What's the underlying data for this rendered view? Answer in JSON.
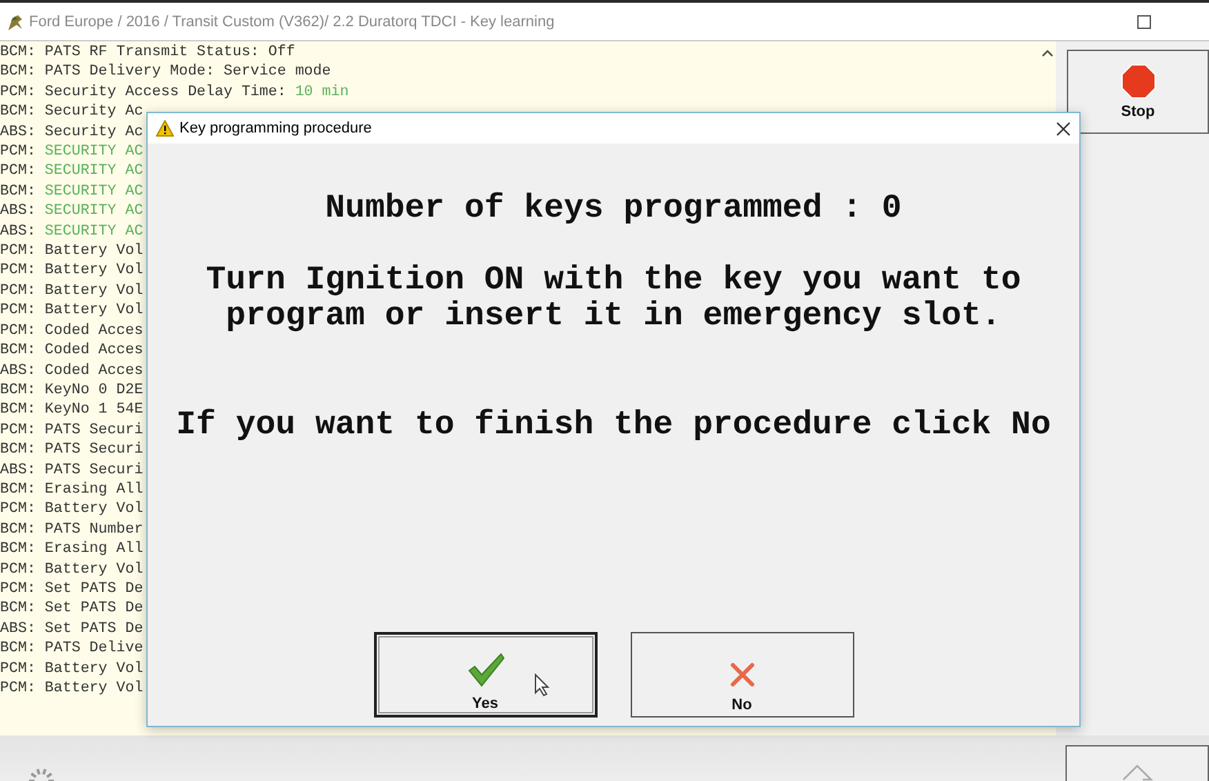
{
  "window": {
    "title": "Ford Europe / 2016 / Transit Custom (V362)/ 2.2 Duratorq TDCI - Key learning"
  },
  "log": {
    "lines": [
      {
        "text": "BCM: PATS RF Transmit Status: Off"
      },
      {
        "text": "BCM: PATS Delivery Mode: Service mode"
      },
      {
        "text": "PCM: Security Access Delay Time: ",
        "value": "10 min"
      },
      {
        "text": "BCM: Security Ac"
      },
      {
        "text": "ABS: Security Ac"
      },
      {
        "text": "PCM: ",
        "value": "SECURITY AC"
      },
      {
        "text": "PCM: ",
        "value": "SECURITY AC"
      },
      {
        "text": "BCM: ",
        "value": "SECURITY AC"
      },
      {
        "text": "ABS: ",
        "value": "SECURITY AC"
      },
      {
        "text": "ABS: ",
        "value": "SECURITY AC"
      },
      {
        "text": "PCM: Battery Vol"
      },
      {
        "text": "PCM: Battery Vol"
      },
      {
        "text": "PCM: Battery Vol"
      },
      {
        "text": "PCM: Battery Vol"
      },
      {
        "text": "PCM: Coded Acces"
      },
      {
        "text": "BCM: Coded Acces"
      },
      {
        "text": "ABS: Coded Acces"
      },
      {
        "text": "BCM: KeyNo 0 D2E"
      },
      {
        "text": "BCM: KeyNo 1 54E"
      },
      {
        "text": "PCM: PATS Securi"
      },
      {
        "text": "BCM: PATS Securi"
      },
      {
        "text": "ABS: PATS Securi"
      },
      {
        "text": "BCM: Erasing All"
      },
      {
        "text": "PCM: Battery Vol"
      },
      {
        "text": "BCM: PATS Number"
      },
      {
        "text": "BCM: Erasing All"
      },
      {
        "text": "PCM: Battery Vol"
      },
      {
        "text": "PCM: Set PATS De"
      },
      {
        "text": "BCM: Set PATS De"
      },
      {
        "text": "ABS: Set PATS De"
      },
      {
        "text": "BCM: PATS Delive"
      },
      {
        "text": "PCM: Battery Vol"
      },
      {
        "text": "PCM: Battery Vol"
      }
    ]
  },
  "side": {
    "stop_button": "Stop"
  },
  "dialog": {
    "title": "Key programming procedure",
    "count_line": "Number of keys programmed : 0",
    "instruction": "Turn Ignition ON with the key you want to program or insert it in emergency slot.",
    "finish_note": "If you want to finish the procedure click No",
    "buttons": [
      {
        "label": "Yes",
        "kind": "confirm",
        "focused": true
      },
      {
        "label": "No",
        "kind": "cancel",
        "focused": false
      }
    ]
  }
}
